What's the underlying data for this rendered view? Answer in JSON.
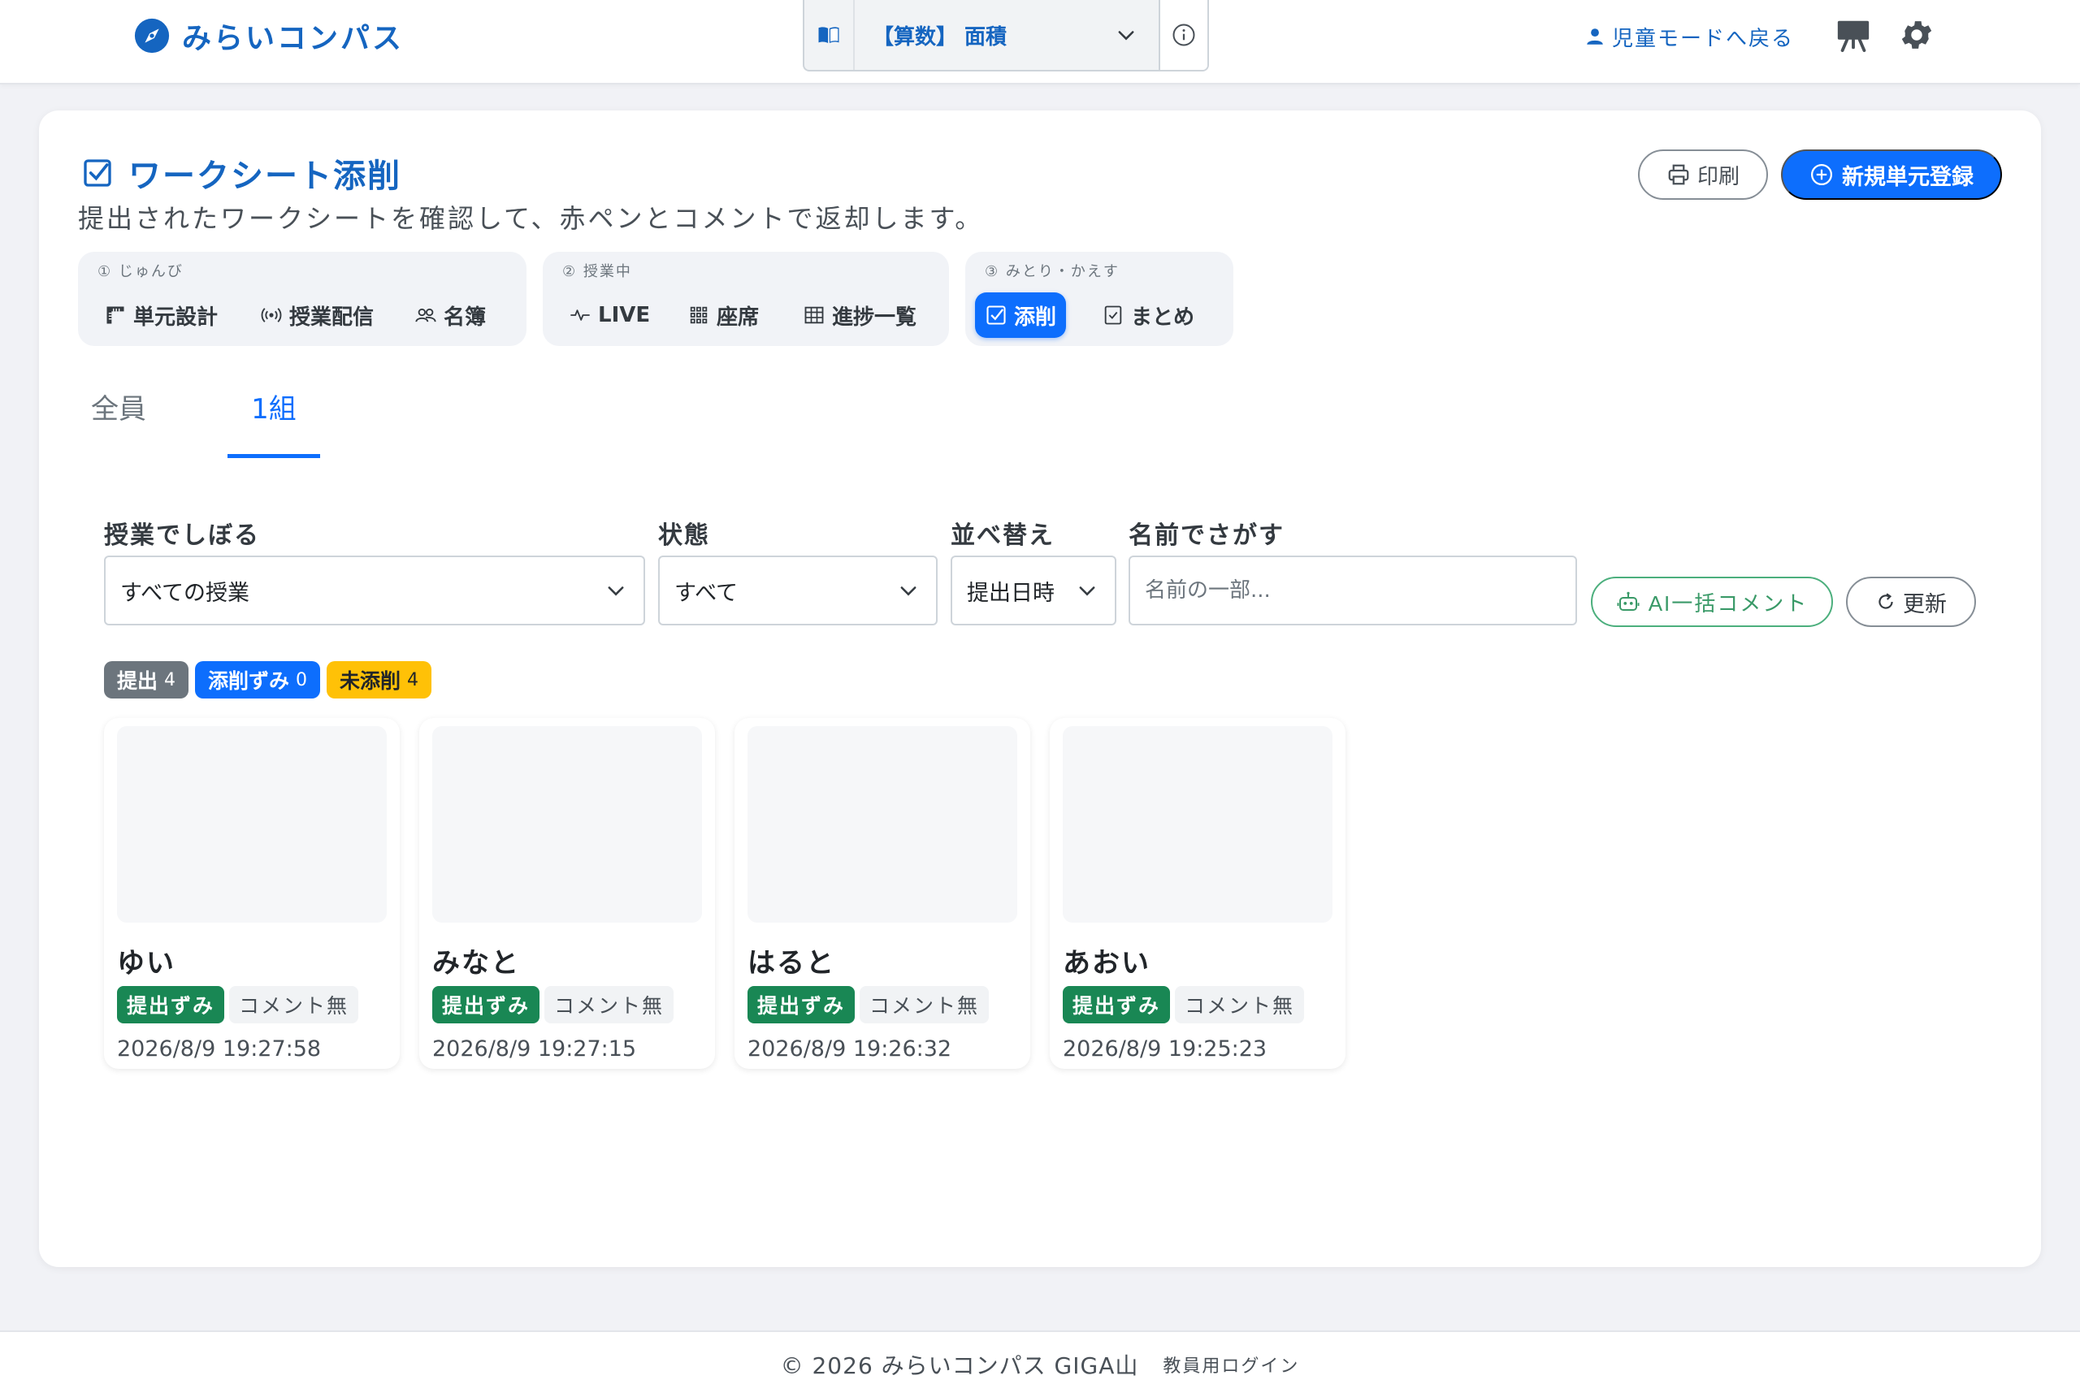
{
  "header": {
    "brand": "みらいコンパス",
    "unit_select_value": "【算数】 面積",
    "child_mode": "児童モードへ戻る"
  },
  "page": {
    "title": "ワークシート添削",
    "subtitle": "提出されたワークシートを確認して、赤ペンとコメントで返却します。",
    "print_label": "印刷",
    "new_unit_label": "新規単元登録"
  },
  "steps": [
    {
      "caption": "① じゅんび",
      "items": [
        "単元設計",
        "授業配信",
        "名簿"
      ]
    },
    {
      "caption": "② 授業中",
      "items": [
        "LIVE",
        "座席",
        "進捗一覧"
      ]
    },
    {
      "caption": "③ みとり・かえす",
      "items": [
        "添削",
        "まとめ"
      ]
    }
  ],
  "tabs": [
    "全員",
    "1組"
  ],
  "filters": {
    "lesson_label": "授業でしぼる",
    "lesson_value": "すべての授業",
    "status_label": "状態",
    "status_value": "すべて",
    "sort_label": "並べ替え",
    "sort_value": "提出日時",
    "name_label": "名前でさがす",
    "name_placeholder": "名前の一部...",
    "ai_button": "AI一括コメント",
    "refresh_button": "更新"
  },
  "counts": [
    {
      "label": "提出",
      "count": "4"
    },
    {
      "label": "添削ずみ",
      "count": "0"
    },
    {
      "label": "未添削",
      "count": "4"
    }
  ],
  "worksheets": [
    {
      "name": "ゆい",
      "status": "提出ずみ",
      "comment": "コメント無",
      "time": "2026/8/9 19:27:58"
    },
    {
      "name": "みなと",
      "status": "提出ずみ",
      "comment": "コメント無",
      "time": "2026/8/9 19:27:15"
    },
    {
      "name": "はると",
      "status": "提出ずみ",
      "comment": "コメント無",
      "time": "2026/8/9 19:26:32"
    },
    {
      "name": "あおい",
      "status": "提出ずみ",
      "comment": "コメント無",
      "time": "2026/8/9 19:25:23"
    }
  ],
  "footer": {
    "copyright": "© 2026 みらいコンパス GIGA山",
    "teacher_login": "教員用ログイン"
  },
  "colors": {
    "accent": "#0d6efd",
    "brand": "#1565c0",
    "submitted": "#198754",
    "pending": "#ffc107"
  }
}
